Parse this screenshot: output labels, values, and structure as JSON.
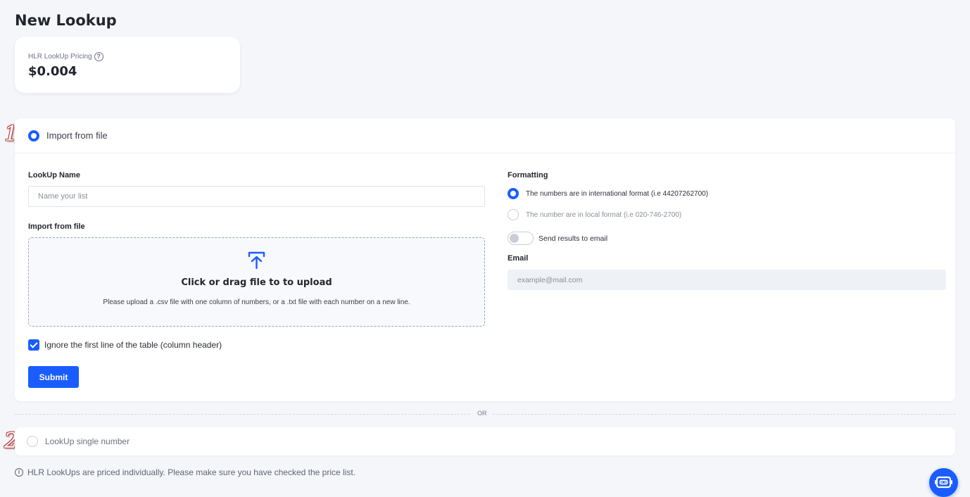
{
  "page": {
    "title": "New Lookup"
  },
  "pricing": {
    "label": "HLR LookUp Pricing",
    "value": "$0.004"
  },
  "markers": {
    "step1": "1",
    "step2": "2"
  },
  "import_section": {
    "option_label": "Import from file",
    "lookup_name_label": "LookUp Name",
    "lookup_name_placeholder": "Name your list",
    "import_label": "Import from file",
    "dropzone_title": "Click or drag file to to upload",
    "dropzone_hint": "Please upload a .csv file with one column of numbers, or a .txt file with each number on a new line.",
    "ignore_header_label": "Ignore the first line of the table (column header)",
    "submit_label": "Submit"
  },
  "formatting": {
    "label": "Formatting",
    "international_label": "The numbers are in international format (i.e 44207262700)",
    "local_label": "The number are in local format (i.e 020-746-2700)",
    "send_email_label": "Send results to email",
    "email_label": "Email",
    "email_placeholder": "example@mail.com"
  },
  "divider": {
    "label": "OR"
  },
  "single_section": {
    "option_label": "LookUp single number"
  },
  "footer": {
    "note": "HLR LookUps are priced individually. Please make sure you have checked the price list."
  },
  "colors": {
    "accent": "#1a5cff",
    "background": "#f4f6fa"
  },
  "icons": {
    "help": "help-circle-icon",
    "upload": "upload-icon",
    "info": "info-icon",
    "chat": "chat-bot-icon"
  }
}
